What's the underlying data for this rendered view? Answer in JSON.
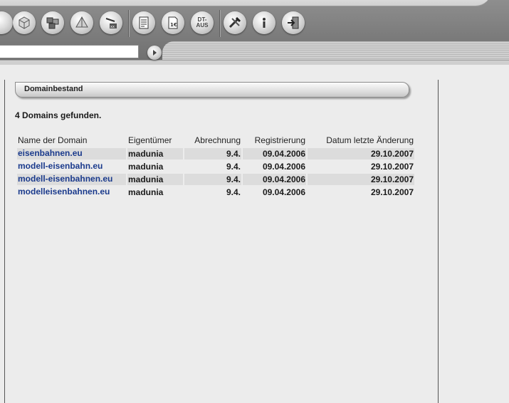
{
  "toolbar": {
    "buttons": [
      {
        "icon": "cube-icon"
      },
      {
        "icon": "cubes-icon"
      },
      {
        "icon": "pyramid-icon"
      },
      {
        "icon": "box-crane-icon"
      },
      {
        "icon": "document-list-icon"
      },
      {
        "icon": "document-euro-icon",
        "label": "1€"
      },
      {
        "icon": "dt-aus-icon",
        "label_top": "DT-",
        "label_bottom": "AUS"
      },
      {
        "icon": "tools-icon"
      },
      {
        "icon": "info-icon"
      },
      {
        "icon": "exit-icon"
      }
    ],
    "address_value": ""
  },
  "section": {
    "title": "Domainbestand"
  },
  "summary": {
    "found_text": "4 Domains gefunden."
  },
  "table": {
    "headers": [
      "Name der Domain",
      "Eigentümer",
      "Abrechnung",
      "Registrierung",
      "Datum letzte Änderung"
    ],
    "rows": [
      {
        "domain": "eisenbahnen.eu",
        "owner": "madunia",
        "billing": "9.4.",
        "registered": "09.04.2006",
        "changed": "29.10.2007"
      },
      {
        "domain": "modell-eisenbahn.eu",
        "owner": "madunia",
        "billing": "9.4.",
        "registered": "09.04.2006",
        "changed": "29.10.2007"
      },
      {
        "domain": "modell-eisenbahnen.eu",
        "owner": "madunia",
        "billing": "9.4.",
        "registered": "09.04.2006",
        "changed": "29.10.2007"
      },
      {
        "domain": "modelleisenbahnen.eu",
        "owner": "madunia",
        "billing": "9.4.",
        "registered": "09.04.2006",
        "changed": "29.10.2007"
      }
    ]
  },
  "colors": {
    "link": "#1a3a8c",
    "row_shade": "#dcdcdc",
    "background": "#ececec"
  }
}
